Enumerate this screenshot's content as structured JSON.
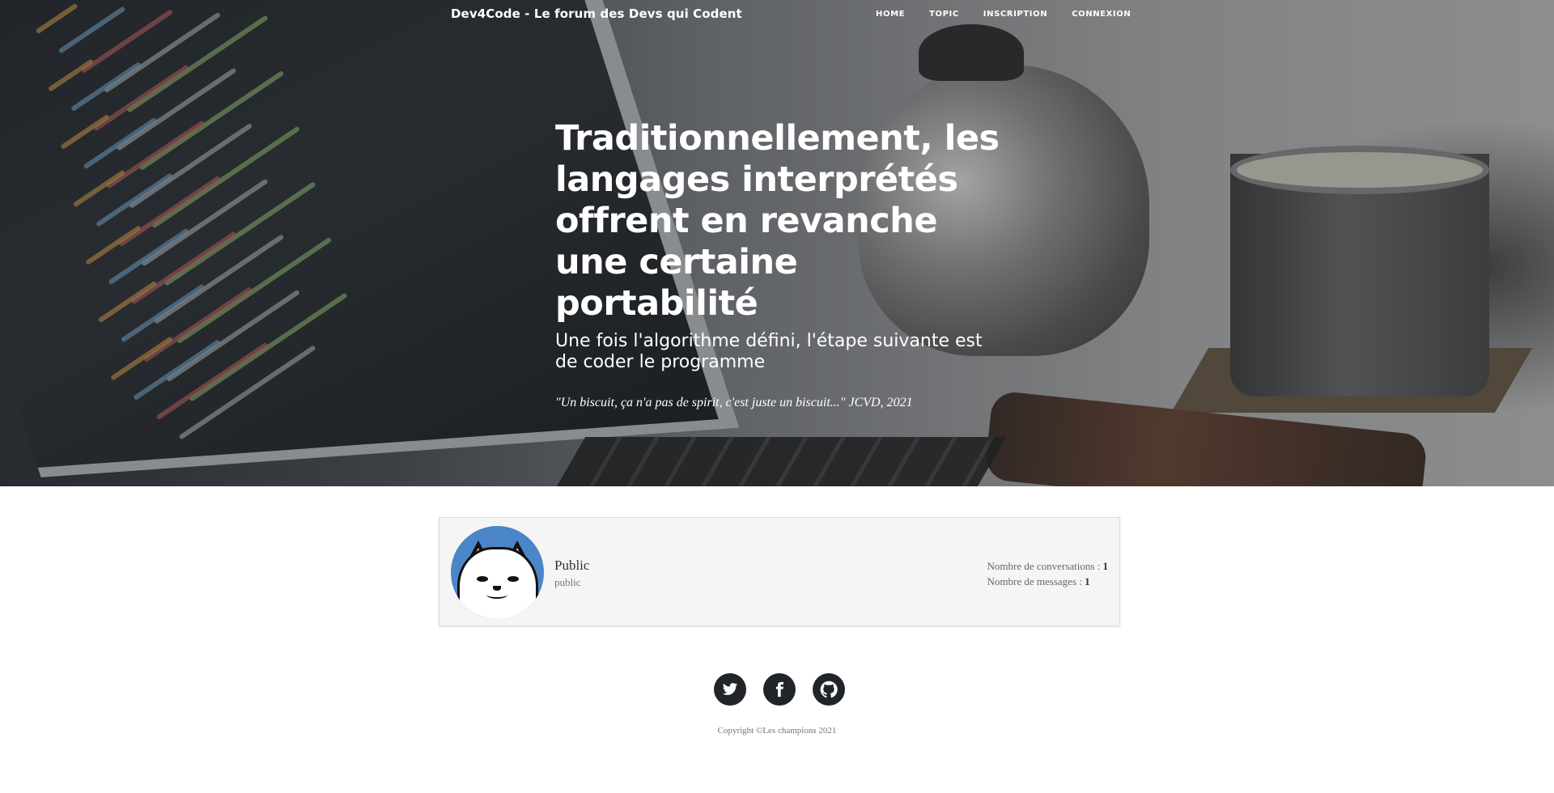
{
  "navbar": {
    "brand": "Dev4Code - Le forum des Devs qui Codent",
    "links": [
      "Home",
      "Topic",
      "Inscription",
      "Connexion"
    ]
  },
  "hero": {
    "title": "Traditionnellement, les langages interprétés offrent en revanche une certaine portabilité",
    "subtitle": "Une fois l'algorithme défini, l'étape suivante est de coder le programme",
    "quote": "\"Un biscuit, ça n'a pas de spirit, c'est juste un biscuit...\" JCVD, 2021"
  },
  "profile": {
    "name": "Public",
    "role": "public",
    "conversations_label": "Nombre de conversations : ",
    "conversations_count": "1",
    "messages_label": "Nombre de messages : ",
    "messages_count": "1"
  },
  "footer": {
    "socials": [
      "twitter-icon",
      "facebook-icon",
      "github-icon"
    ],
    "copyright": "Copyright ©Les champions 2021"
  },
  "colors": {
    "dark": "#212529",
    "avatar_bg": "#4a86c8",
    "card_bg": "#f5f5f5"
  }
}
